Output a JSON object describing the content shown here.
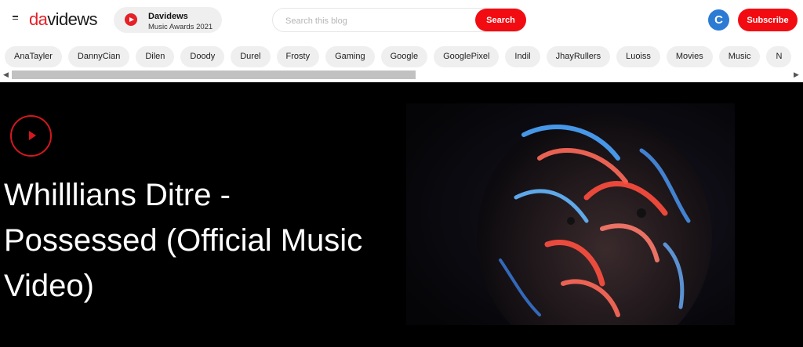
{
  "header": {
    "logo_part1": "da",
    "logo_part2": "videws",
    "award_title": "Davidews",
    "award_subtitle": "Music Awards 2021",
    "search_placeholder": "Search this blog",
    "search_label": "Search",
    "circle_icon_glyph": "C",
    "subscribe_label": "Subscribe"
  },
  "labels": [
    "AnaTayler",
    "DannyCian",
    "Dilen",
    "Doody",
    "Durel",
    "Frosty",
    "Gaming",
    "Google",
    "GooglePixel",
    "Indil",
    "JhayRullers",
    "Luoiss",
    "Movies",
    "Music",
    "N"
  ],
  "hero": {
    "title": "Whilllians Ditre - Possessed (Official Music Video)"
  },
  "colors": {
    "accent": "#f20c12",
    "brand_red": "#e52027",
    "icon_blue": "#2b7bd4"
  }
}
